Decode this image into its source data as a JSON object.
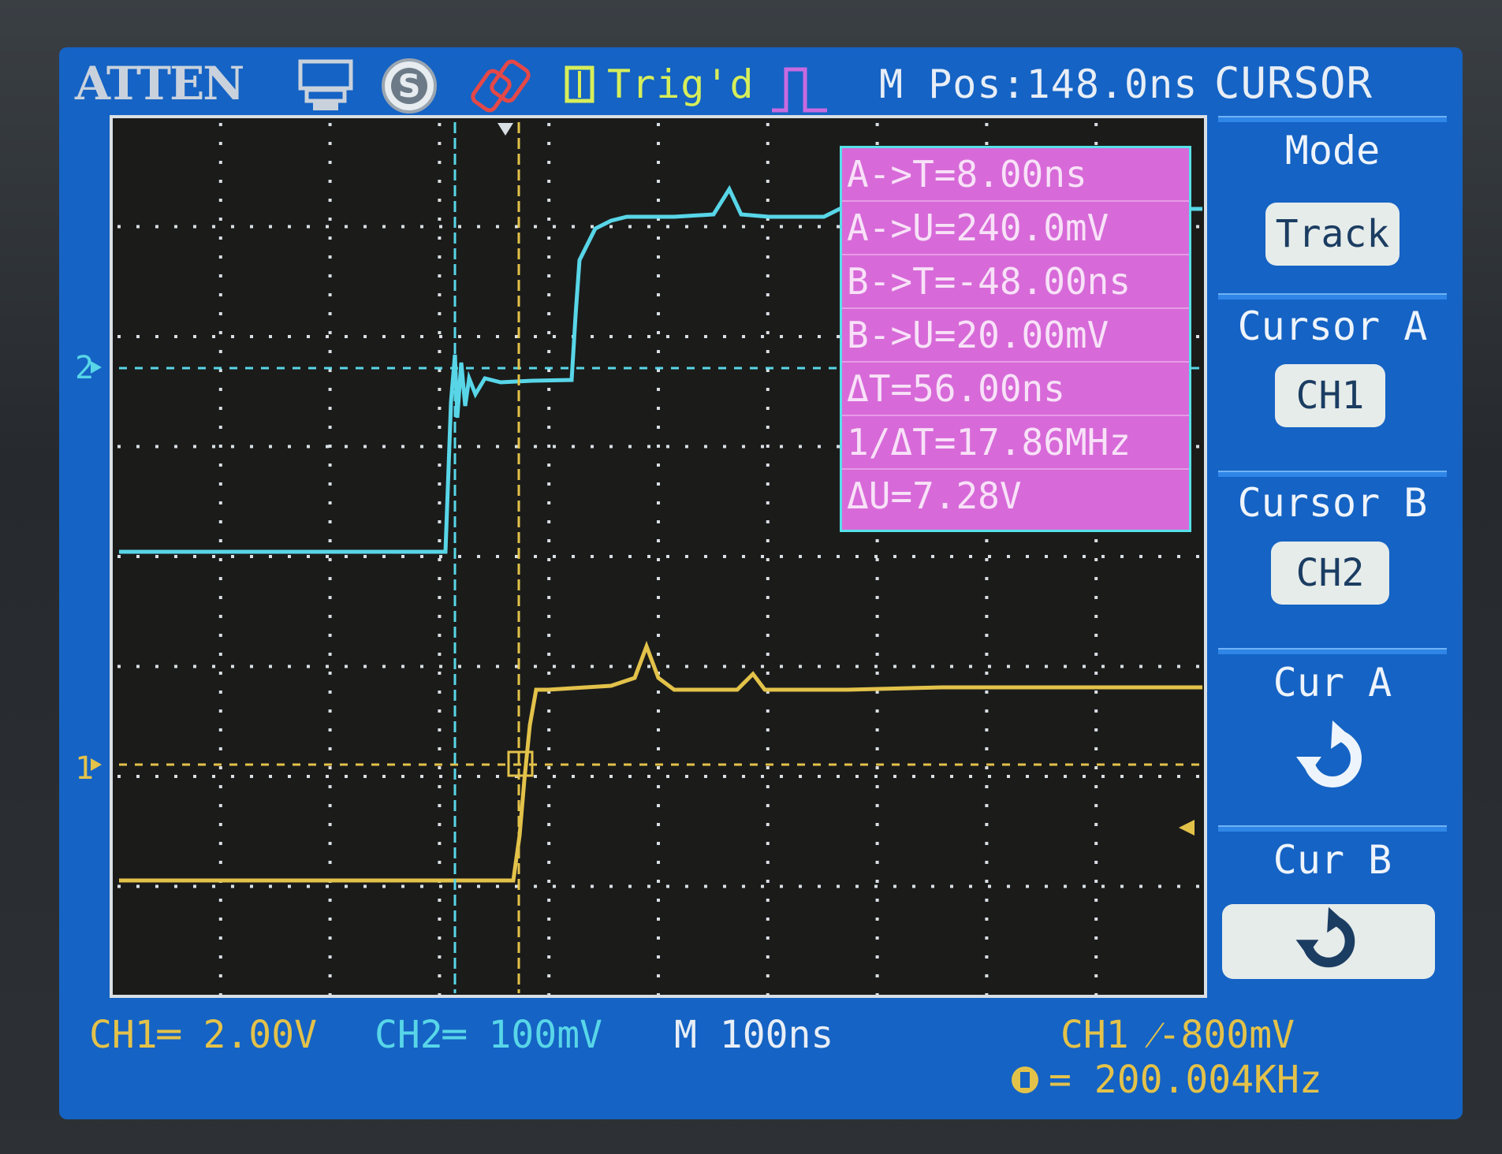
{
  "top_bar": {
    "brand": "ATTEN",
    "trigger_status": "Trig'd",
    "m_pos": "M Pos:148.0ns",
    "menu_title": "CURSOR"
  },
  "cursor_readout": [
    "A->T=8.00ns",
    "A->U=240.0mV",
    "B->T=-48.00ns",
    "B->U=20.00mV",
    "ΔT=56.00ns",
    "1/ΔT=17.86MHz",
    "ΔU=7.28V"
  ],
  "side_menu": {
    "mode_label": "Mode",
    "mode_value": "Track",
    "cursor_a_label": "Cursor A",
    "cursor_a_value": "CH1",
    "cursor_b_label": "Cursor B",
    "cursor_b_value": "CH2",
    "cur_a_label": "Cur A",
    "cur_b_label": "Cur B"
  },
  "channel_markers": {
    "ch1": "1",
    "ch2": "2"
  },
  "bottom_bar": {
    "ch1_scale": "CH1═ 2.00V",
    "ch2_scale": "CH2═ 100mV",
    "timebase": "M 100ns",
    "trigger": "CH1 ⁄-800mV",
    "frequency": "= 200.004KHz"
  },
  "colors": {
    "screen_bg": "#1563c4",
    "grid_bg": "#1b1c1a",
    "ch1": "#e3c24a",
    "ch2": "#58d6e8",
    "cursor_box": "#d76ad8"
  },
  "icons": [
    "usb-printer-icon",
    "save-icon",
    "link-icon",
    "trigger-edge-icon",
    "rotate-knob-icon"
  ]
}
